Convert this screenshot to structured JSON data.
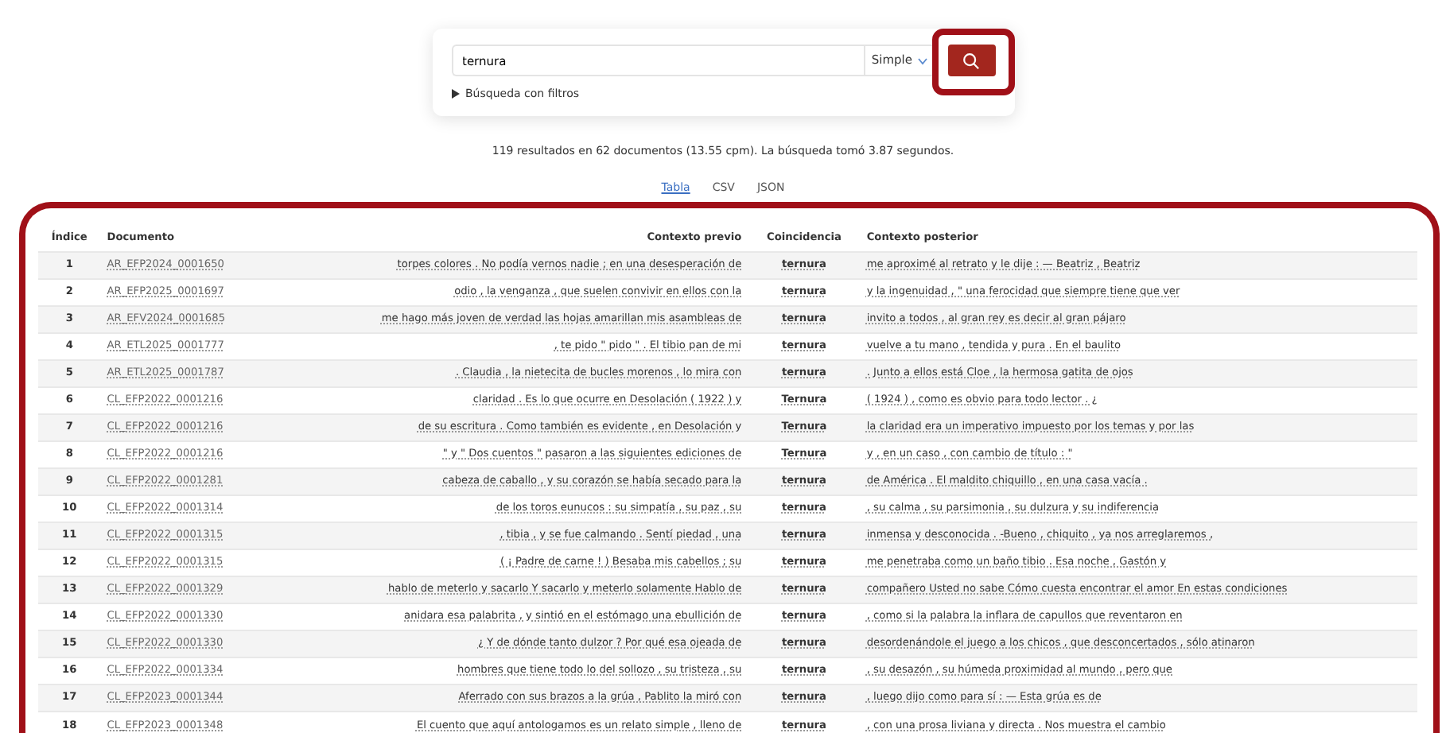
{
  "search": {
    "value": "ternura",
    "mode": "Simple",
    "filters_label": "Búsqueda con filtros",
    "highlighted": true
  },
  "summary": "119 resultados en 62 documentos (13.55 cpm). La búsqueda tomó 3.87 segundos.",
  "tabs": [
    {
      "label": "Tabla",
      "selected": true
    },
    {
      "label": "CSV",
      "selected": false
    },
    {
      "label": "JSON",
      "selected": false
    }
  ],
  "table": {
    "highlighted": true,
    "columns": [
      "Índice",
      "Documento",
      "Contexto previo",
      "Coincidencia",
      "Contexto posterior"
    ],
    "rows": [
      [
        "1",
        "AR_EFP2024_0001650",
        "torpes colores . No podía vernos nadie ; en una desesperación de",
        "ternura",
        "me aproximé al retrato y le dije : — Beatriz , Beatriz"
      ],
      [
        "2",
        "AR_EFP2025_0001697",
        "odio , la venganza , que suelen convivir en ellos con la",
        "ternura",
        "y la ingenuidad , \" una ferocidad que siempre tiene que ver"
      ],
      [
        "3",
        "AR_EFV2024_0001685",
        "me hago más joven de verdad las hojas amarillan mis asambleas de",
        "ternura",
        "invito a todos , al gran rey es decir al gran pájaro"
      ],
      [
        "4",
        "AR_ETL2025_0001777",
        ", te pido \" pido \" . El tibio pan de mi",
        "ternura",
        "vuelve a tu mano , tendida y pura . En el baulito"
      ],
      [
        "5",
        "AR_ETL2025_0001787",
        ". Claudia , la nietecita de bucles morenos , lo mira con",
        "ternura",
        ". Junto a ellos está Cloe , la hermosa gatita de ojos"
      ],
      [
        "6",
        "CL_EFP2022_0001216",
        "claridad . Es lo que ocurre en Desolación ( 1922 ) y",
        "Ternura",
        "( 1924 ) , como es obvio para todo lector . ¿"
      ],
      [
        "7",
        "CL_EFP2022_0001216",
        "de su escritura . Como también es evidente , en Desolación y",
        "Ternura",
        "la claridad era un imperativo impuesto por los temas y por las"
      ],
      [
        "8",
        "CL_EFP2022_0001216",
        "\" y \" Dos cuentos \" pasaron a las siguientes ediciones de",
        "Ternura",
        "y , en un caso , con cambio de título : \""
      ],
      [
        "9",
        "CL_EFP2022_0001281",
        "cabeza de caballo , y su corazón se había secado para la",
        "ternura",
        "de América . El maldito chiquillo , en una casa vacía ."
      ],
      [
        "10",
        "CL_EFP2022_0001314",
        "de los toros eunucos : su simpatía , su paz , su",
        "ternura",
        ", su calma , su parsimonia , su dulzura y su indiferencia"
      ],
      [
        "11",
        "CL_EFP2022_0001315",
        ", tibia , y se fue calmando . Sentí piedad , una",
        "ternura",
        "inmensa y desconocida . -Bueno , chiquito , ya nos arreglaremos ,"
      ],
      [
        "12",
        "CL_EFP2022_0001315",
        "( ¡ Padre de carne ! ) Besaba mis cabellos ; su",
        "ternura",
        "me penetraba como un baño tibio . Esa noche , Gastón y"
      ],
      [
        "13",
        "CL_EFP2022_0001329",
        "hablo de meterlo y sacarlo Y sacarlo y meterlo solamente Hablo de",
        "ternura",
        "compañero Usted no sabe Cómo cuesta encontrar el amor En estas condiciones"
      ],
      [
        "14",
        "CL_EFP2022_0001330",
        "anidara esa palabrita , y sintió en el estómago una ebullición de",
        "ternura",
        ", como si la palabra la inflara de capullos que reventaron en"
      ],
      [
        "15",
        "CL_EFP2022_0001330",
        "¿ Y de dónde tanto dulzor ? Por qué esa ojeada de",
        "ternura",
        "desordenándole el juego a los chicos , que desconcertados , sólo atinaron"
      ],
      [
        "16",
        "CL_EFP2022_0001334",
        "hombres que tiene todo lo del sollozo , su tristeza , su",
        "ternura",
        ", su desazón , su húmeda proximidad al mundo , pero que"
      ],
      [
        "17",
        "CL_EFP2023_0001344",
        "Aferrado con sus brazos a la grúa , Pablito la miró con",
        "ternura",
        ", luego dijo como para sí : — Esta grúa es de"
      ],
      [
        "18",
        "CL_EFP2023_0001348",
        "El cuento que aquí antologamos es un relato simple , lleno de",
        "ternura",
        ", con una prosa liviana y directa . Nos muestra el cambio"
      ]
    ]
  }
}
